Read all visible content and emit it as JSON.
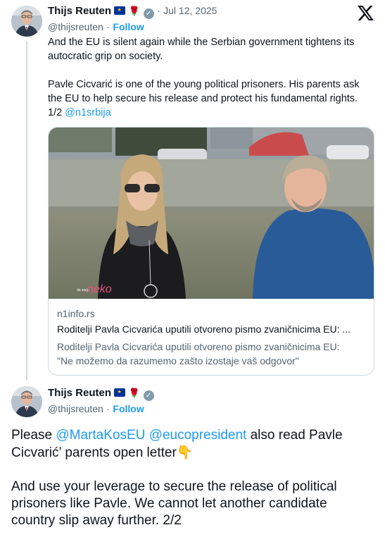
{
  "tweet1": {
    "author_name": "Thijs Reuten",
    "handle": "@thijsreuten",
    "separator": "·",
    "date_separator": "·",
    "date": "Jul 12, 2025",
    "follow_label": "Follow",
    "text_line1": "And the EU is silent again while the Serbian government tightens its",
    "text_line2": "autocratic grip on society.",
    "text_line3": "Pavle Cicvarić is one of the young political prisoners. His parents ask",
    "text_line4": "the EU to help secure his release and protect his fundamental rights.",
    "text_line5_prefix": "1/2",
    "text_line5_mention": "@n1srbija",
    "card": {
      "domain": "n1info.rs",
      "title": "Roditelji Pavla Cicvarića uputili otvoreno pismo zvaničnicima EU: ...",
      "desc_line1": "Roditelji Pavla Cicvarića uputili otvoreno pismo zvaničnicima EU:",
      "desc_line2": "\"Ne možemo da razumemo zašto izostaje vaš odgovor\"",
      "watermark_small": "da\nsorja",
      "watermark": "neko"
    }
  },
  "tweet2": {
    "author_name": "Thijs Reuten",
    "handle": "@thijsreuten",
    "separator": "·",
    "follow_label": "Follow",
    "line1_prefix": "Please",
    "mention1": "@MartaKosEU",
    "mention2": "@eucopresident",
    "line1_suffix": "also read Pavle",
    "line2": "Cicvarić’ parents open letter",
    "line2_emoji": "👇",
    "line3": "And use your leverage to secure the release of political",
    "line4": "prisoners like Pavle. We cannot let another candidate",
    "line5": "country slip away further. 2/2"
  },
  "icons": {
    "x_logo": "x-logo-icon",
    "flag": "eu-flag-icon",
    "rose": "rose-icon",
    "verified": "verified-badge-icon"
  },
  "colors": {
    "link": "#1d9bf0",
    "secondary": "#536471",
    "border": "#cfd9de",
    "text": "#0f1419"
  }
}
